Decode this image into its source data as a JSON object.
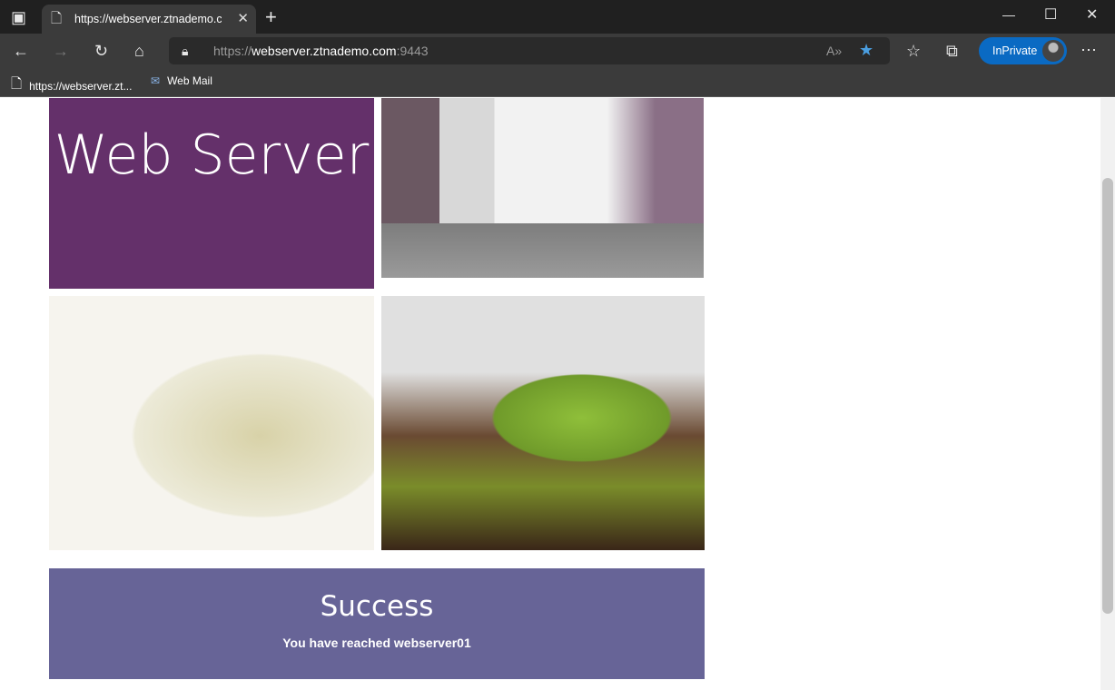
{
  "browser": {
    "tab_title": "https://webserver.ztnademo.com:9443",
    "url_scheme": "https://",
    "url_host": "webserver.ztnademo.com",
    "url_port": ":9443",
    "inprivate_label": "InPrivate",
    "favorite_color": "#4a9ee0",
    "bookmarks": [
      {
        "label": "https://webserver.zt...",
        "icon": "page-icon"
      },
      {
        "label": "Web Mail",
        "icon": "mail-icon"
      }
    ]
  },
  "page": {
    "hero_title": "Web Server",
    "hero_color": "#64306a",
    "success_title": "Success",
    "success_message": "You have reached webserver01",
    "success_color": "#676497"
  }
}
